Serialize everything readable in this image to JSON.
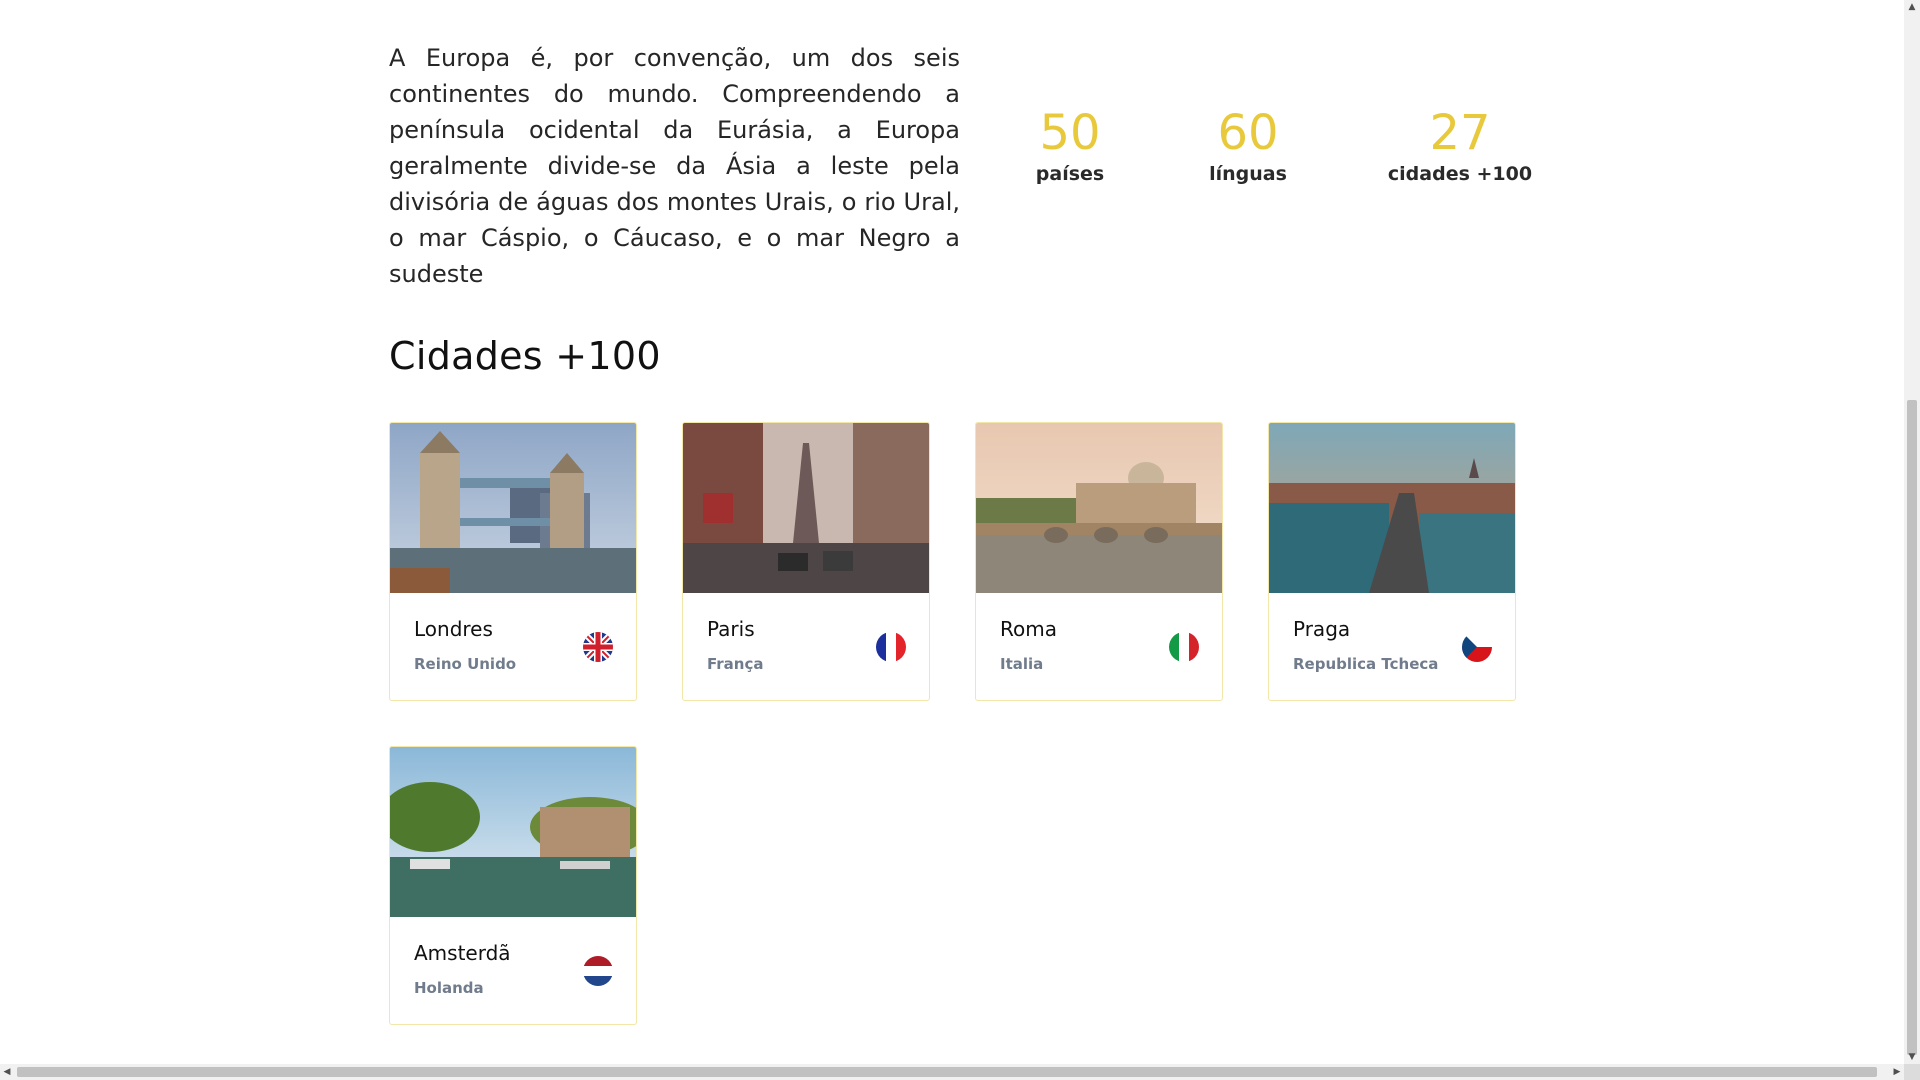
{
  "intro": {
    "text": "A Europa é, por convenção, um dos seis continentes do mundo. Compreendendo a península ocidental da Eurásia, a Europa geralmente divide-se da Ásia a leste pela divisória de águas dos montes Urais, o rio Ural, o mar Cáspio, o Cáucaso, e o mar Negro a sudeste"
  },
  "stats": [
    {
      "number": "50",
      "label": "países"
    },
    {
      "number": "60",
      "label": "línguas"
    },
    {
      "number": "27",
      "label": "cidades +100"
    }
  ],
  "section": {
    "title": "Cidades +100"
  },
  "cities": [
    {
      "city": "Londres",
      "country": "Reino Unido",
      "flag": "uk-flag-icon"
    },
    {
      "city": "Paris",
      "country": "França",
      "flag": "france-flag-icon"
    },
    {
      "city": "Roma",
      "country": "Italia",
      "flag": "italy-flag-icon"
    },
    {
      "city": "Praga",
      "country": "Republica Tcheca",
      "flag": "czech-flag-icon"
    },
    {
      "city": "Amsterdã",
      "country": "Holanda",
      "flag": "netherlands-flag-icon"
    }
  ],
  "colors": {
    "accent": "#e9c93c",
    "card_border": "#f2e6a8",
    "muted": "#707b8c"
  }
}
